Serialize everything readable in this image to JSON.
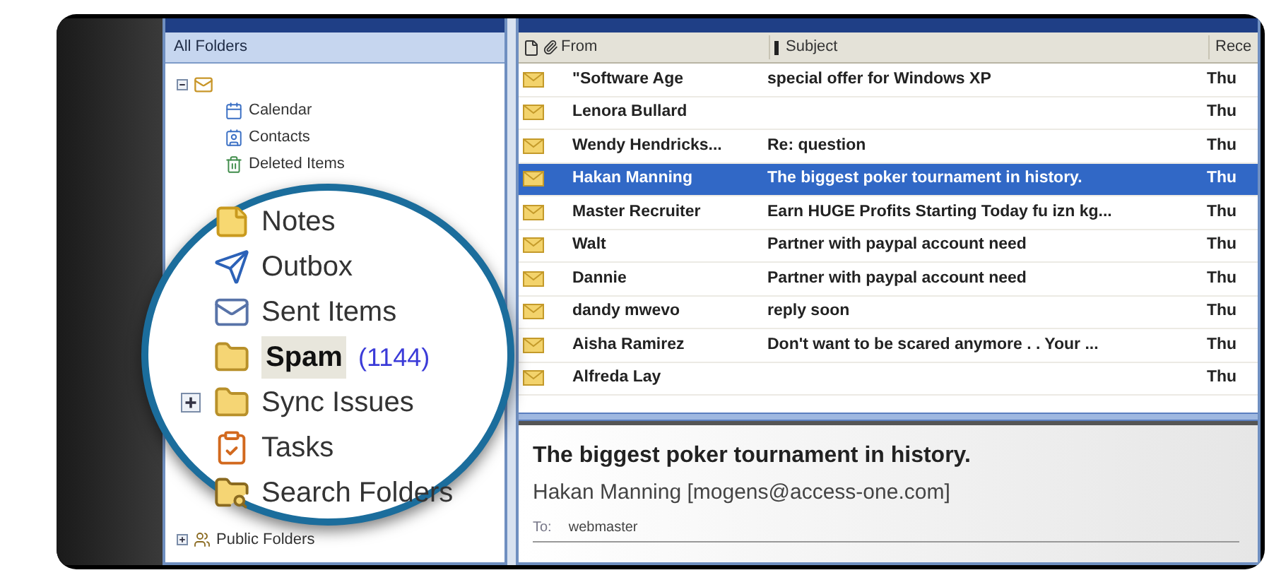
{
  "folder_pane": {
    "header": "All Folders",
    "root_expanded": true,
    "tree": [
      {
        "label": "Calendar",
        "kind": "calendar"
      },
      {
        "label": "Contacts",
        "kind": "contacts"
      },
      {
        "label": "Deleted Items",
        "kind": "deleted"
      }
    ],
    "bottom": [
      {
        "label": "Public Folders",
        "kind": "public",
        "expanded": false
      }
    ]
  },
  "magnifier": {
    "items": [
      {
        "label": "Notes",
        "kind": "notes",
        "selected": false
      },
      {
        "label": "Outbox",
        "kind": "outbox",
        "selected": false
      },
      {
        "label": "Sent Items",
        "kind": "sent",
        "selected": false
      },
      {
        "label": "Spam",
        "count": "(1144)",
        "kind": "folder",
        "selected": true
      },
      {
        "label": "Sync Issues",
        "kind": "folder",
        "selected": false,
        "expanded": false
      },
      {
        "label": "Tasks",
        "kind": "tasks",
        "selected": false
      },
      {
        "label": "Search Folders",
        "kind": "search",
        "selected": false
      }
    ]
  },
  "message_list": {
    "columns": [
      "From",
      "Subject",
      "Rece"
    ],
    "rows": [
      {
        "from": "\"Software Age",
        "subject": "special offer for Windows XP",
        "received": "Thu",
        "selected": false
      },
      {
        "from": "Lenora Bullard",
        "subject": "",
        "received": "Thu",
        "selected": false
      },
      {
        "from": "Wendy Hendricks...",
        "subject": "Re: question",
        "received": "Thu",
        "selected": false
      },
      {
        "from": "Hakan Manning",
        "subject": "The biggest poker tournament in history.",
        "received": "Thu",
        "selected": true
      },
      {
        "from": "Master Recruiter",
        "subject": "Earn HUGE Profits Starting Today fu izn kg...",
        "received": "Thu",
        "selected": false
      },
      {
        "from": "Walt",
        "subject": "Partner with paypal account need",
        "received": "Thu",
        "selected": false
      },
      {
        "from": "Dannie",
        "subject": "Partner with paypal account need",
        "received": "Thu",
        "selected": false
      },
      {
        "from": "dandy mwevo",
        "subject": "reply soon",
        "received": "Thu",
        "selected": false
      },
      {
        "from": "Aisha Ramirez",
        "subject": "Don't want to be scared anymore . . Your ...",
        "received": "Thu",
        "selected": false
      },
      {
        "from": "Alfreda Lay",
        "subject": "",
        "received": "Thu",
        "selected": false
      }
    ]
  },
  "preview": {
    "subject": "The biggest poker tournament in history.",
    "sender": "Hakan Manning [mogens@access-one.com]",
    "to_label": "To:",
    "to": "webmaster"
  }
}
